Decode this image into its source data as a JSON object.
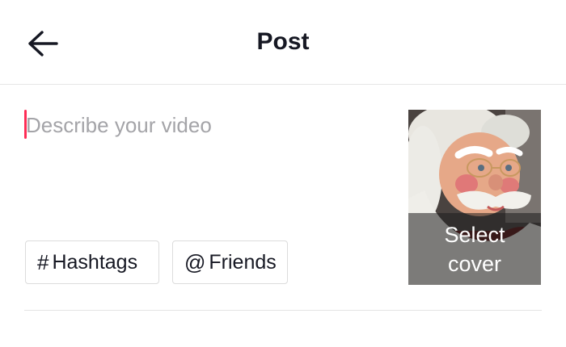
{
  "header": {
    "title": "Post",
    "back_icon": "arrow-left-icon"
  },
  "description": {
    "placeholder": "Describe your video",
    "value": "",
    "caret_color": "#fe2c55"
  },
  "chips": {
    "hashtags": {
      "symbol": "#",
      "label": "Hashtags"
    },
    "friends": {
      "symbol": "@",
      "label": "Friends"
    }
  },
  "cover": {
    "label": "Select cover"
  },
  "colors": {
    "text_primary": "#161823",
    "placeholder": "#a4a4a8",
    "accent": "#fe2c55",
    "border": "#dcdcdc"
  }
}
